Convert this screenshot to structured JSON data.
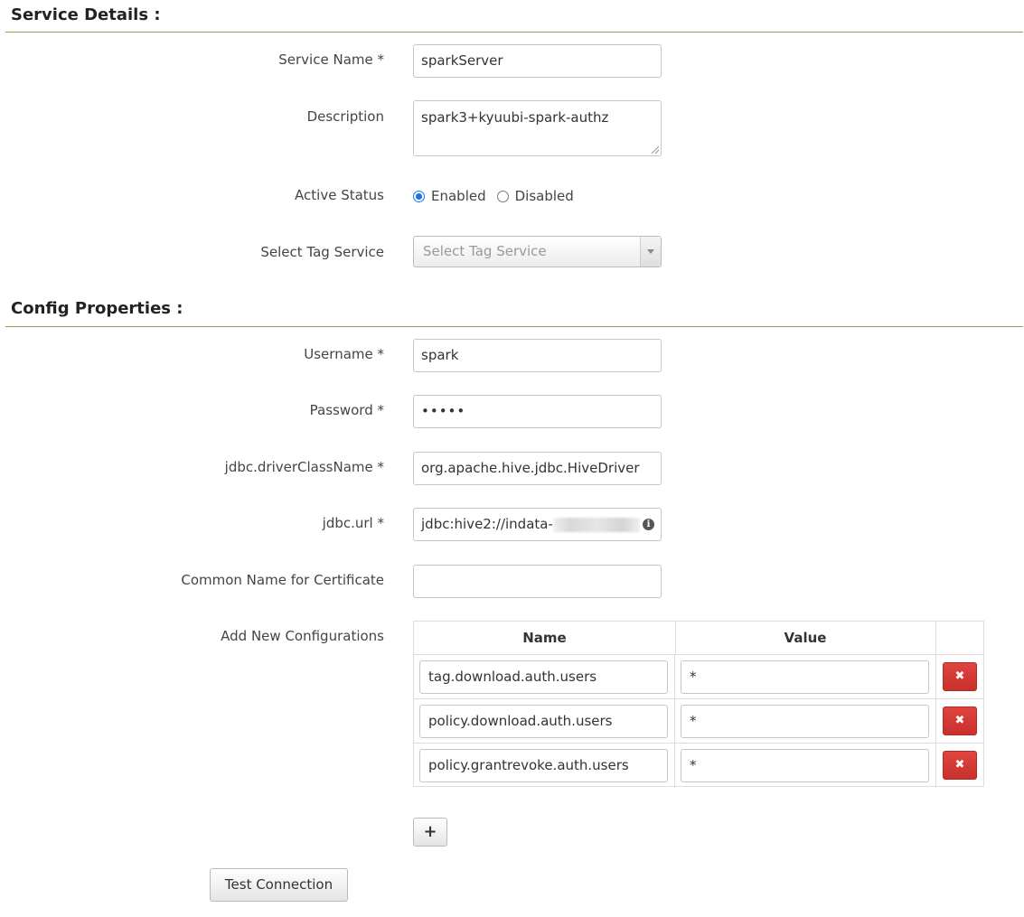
{
  "service_details": {
    "title": "Service Details :",
    "service_name": {
      "label": "Service Name *",
      "value": "sparkServer"
    },
    "description": {
      "label": "Description",
      "value": "spark3+kyuubi-spark-authz"
    },
    "active_status": {
      "label": "Active Status",
      "options": [
        "Enabled",
        "Disabled"
      ],
      "selected": "Enabled"
    },
    "tag_service": {
      "label": "Select Tag Service",
      "placeholder": "Select Tag Service"
    }
  },
  "config_properties": {
    "title": "Config Properties :",
    "username": {
      "label": "Username *",
      "value": "spark"
    },
    "password": {
      "label": "Password *",
      "value": "•••••"
    },
    "jdbc_driver": {
      "label": "jdbc.driverClassName *",
      "value": "org.apache.hive.jdbc.HiveDriver"
    },
    "jdbc_url": {
      "label": "jdbc.url *",
      "value": "jdbc:hive2://indata-",
      "info_icon": "info-icon"
    },
    "common_name": {
      "label": "Common Name for Certificate",
      "value": ""
    },
    "new_configs": {
      "label": "Add New Configurations",
      "headers": {
        "name": "Name",
        "value": "Value"
      },
      "rows": [
        {
          "name": "tag.download.auth.users",
          "value": "*",
          "delete": "✖"
        },
        {
          "name": "policy.download.auth.users",
          "value": "*",
          "delete": "✖"
        },
        {
          "name": "policy.grantrevoke.auth.users",
          "value": "*",
          "delete": "✖"
        }
      ],
      "add_label": "+"
    }
  },
  "actions": {
    "test_connection": "Test Connection"
  },
  "colors": {
    "section_rule": "#8aa34e",
    "danger": "#d9534f",
    "radio_accent": "#1a73e8"
  }
}
